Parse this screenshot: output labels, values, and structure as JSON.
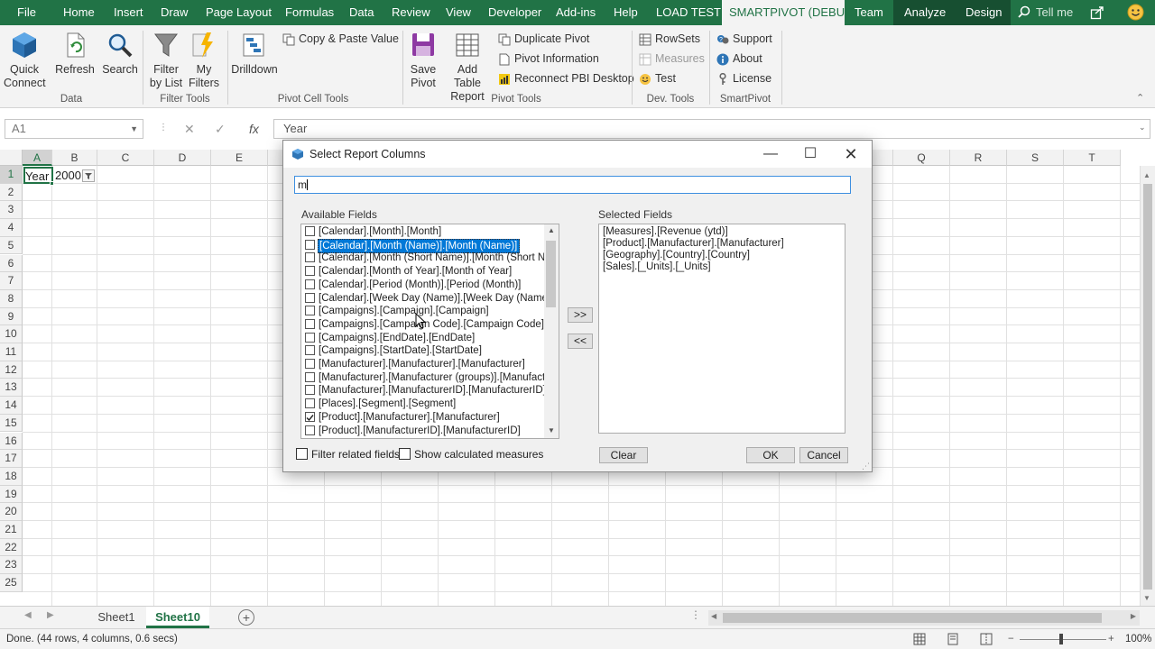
{
  "ribbon_tabs": [
    "File",
    "Home",
    "Insert",
    "Draw",
    "Page Layout",
    "Formulas",
    "Data",
    "Review",
    "View",
    "Developer",
    "Add-ins",
    "Help",
    "LOAD TEST",
    "SMARTPIVOT (DEBUG)",
    "Team",
    "Analyze",
    "Design"
  ],
  "tell_me": "Tell me",
  "ribbon": {
    "data_group": {
      "quick_connect": "Quick Connect",
      "refresh": "Refresh",
      "search": "Search",
      "label": "Data"
    },
    "filter_group": {
      "filter_by_list": "Filter by List",
      "my_filters": "My Filters",
      "label": "Filter Tools"
    },
    "pivot_cell_group": {
      "drilldown": "Drilldown",
      "copy_paste": "Copy & Paste Value",
      "label": "Pivot Cell Tools"
    },
    "pivot_tools_group": {
      "save_pivot": "Save Pivot",
      "add_table_report": "Add Table Report",
      "duplicate_pivot": "Duplicate Pivot",
      "pivot_information": "Pivot Information",
      "reconnect": "Reconnect PBI Desktop",
      "label": "Pivot Tools"
    },
    "dev_group": {
      "rowsets": "RowSets",
      "measures": "Measures",
      "test": "Test",
      "label": "Dev. Tools"
    },
    "smartpivot_group": {
      "support": "Support",
      "about": "About",
      "license": "License",
      "label": "SmartPivot"
    }
  },
  "formula_bar": {
    "name_box": "A1",
    "cancel": "✕",
    "enter": "✓",
    "fx": "fx",
    "content": "Year"
  },
  "columns": [
    "A",
    "B",
    "C",
    "D",
    "E",
    "F",
    "G",
    "H",
    "I",
    "J",
    "K",
    "L",
    "M",
    "N",
    "O",
    "P",
    "Q",
    "R",
    "S",
    "T"
  ],
  "rows": [
    "1",
    "2",
    "3",
    "4",
    "5",
    "6",
    "7",
    "8",
    "9",
    "10",
    "11",
    "12",
    "13",
    "14",
    "15",
    "16",
    "17",
    "18",
    "19",
    "20",
    "21",
    "22",
    "23",
    "25"
  ],
  "cells": {
    "a1": "Year",
    "b1": "2000"
  },
  "dialog": {
    "title": "Select Report Columns",
    "search_value": "m",
    "available_label": "Available Fields",
    "selected_label": "Selected Fields",
    "available_fields": [
      "[Calendar].[Month].[Month]",
      "[Calendar].[Month (Name)].[Month (Name)]",
      "[Calendar].[Month (Short Name)].[Month (Short Nam",
      "[Calendar].[Month of Year].[Month of Year]",
      "[Calendar].[Period (Month)].[Period (Month)]",
      "[Calendar].[Week Day (Name)].[Week Day (Name)]",
      "[Campaigns].[Campaign].[Campaign]",
      "[Campaigns].[Campaign Code].[Campaign Code]",
      "[Campaigns].[EndDate].[EndDate]",
      "[Campaigns].[StartDate].[StartDate]",
      "[Manufacturer].[Manufacturer].[Manufacturer]",
      "[Manufacturer].[Manufacturer (groups)].[Manufactur",
      "[Manufacturer].[ManufacturerID].[ManufacturerID]",
      "[Places].[Segment].[Segment]",
      "[Product].[Manufacturer].[Manufacturer]",
      "[Product].[ManufacturerID].[ManufacturerID]"
    ],
    "selected_fields": [
      "[Measures].[Revenue (ytd)]",
      "[Product].[Manufacturer].[Manufacturer]",
      "[Geography].[Country].[Country]",
      "[Sales].[_Units].[_Units]"
    ],
    "add_button": ">>",
    "remove_button": "<<",
    "filter_related": "Filter related fields",
    "show_calculated": "Show calculated measures",
    "clear": "Clear",
    "ok": "OK",
    "cancel": "Cancel"
  },
  "sheets": [
    "Sheet1",
    "Sheet10"
  ],
  "status": {
    "text": "Done. (44 rows, 4 columns, 0.6 secs)",
    "zoom": "100%"
  },
  "colors": {
    "excel_green": "#217346",
    "selection_blue": "#0078d7"
  }
}
